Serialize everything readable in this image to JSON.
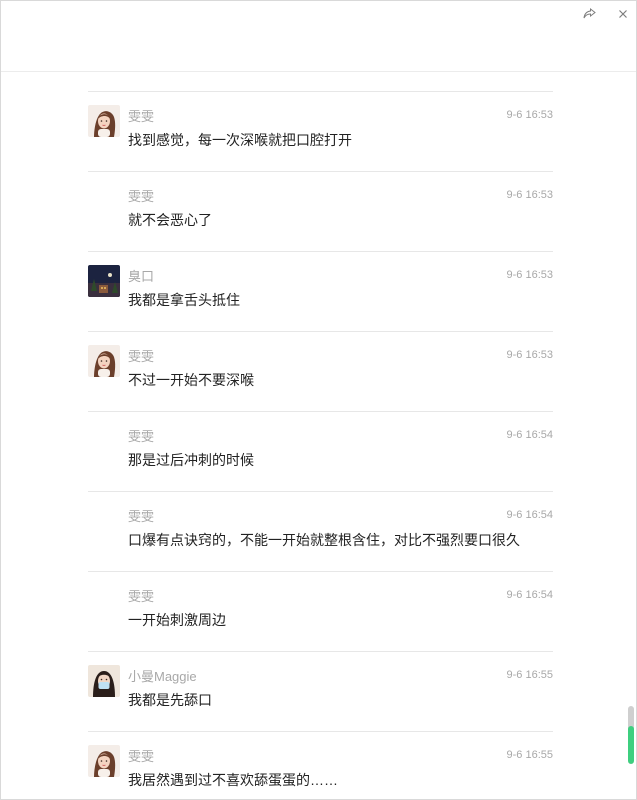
{
  "window": {
    "share_icon": "share-arrow-icon",
    "close_icon": "close-icon"
  },
  "messages": [
    {
      "name": "雯雯",
      "time": "9-6 16:53",
      "text": "找到感觉，每一次深喉就把口腔打开",
      "avatar": "woman-avatar"
    },
    {
      "name": "雯雯",
      "time": "9-6 16:53",
      "text": "就不会恶心了",
      "avatar": ""
    },
    {
      "name": "臭口",
      "time": "9-6 16:53",
      "text": "我都是拿舌头抵住",
      "avatar": "night-scene-avatar"
    },
    {
      "name": "雯雯",
      "time": "9-6 16:53",
      "text": "不过一开始不要深喉",
      "avatar": "woman-avatar"
    },
    {
      "name": "雯雯",
      "time": "9-6 16:54",
      "text": "那是过后冲刺的时候",
      "avatar": ""
    },
    {
      "name": "雯雯",
      "time": "9-6 16:54",
      "text": "口爆有点诀窍的，不能一开始就整根含住，对比不强烈要口很久",
      "avatar": ""
    },
    {
      "name": "雯雯",
      "time": "9-6 16:54",
      "text": "一开始刺激周边",
      "avatar": ""
    },
    {
      "name": "小曼Maggie",
      "time": "9-6 16:55",
      "text": "我都是先舔口",
      "avatar": "masked-girl-avatar"
    },
    {
      "name": "雯雯",
      "time": "9-6 16:55",
      "text": "我居然遇到过不喜欢舔蛋蛋的……",
      "avatar": "woman-avatar"
    }
  ],
  "colors": {
    "name": "#a8a8a8",
    "time": "#a8a8a8",
    "text": "#222222",
    "divider": "#e7e7e7",
    "scroll_accent": "#3ecf7f"
  },
  "scroll_position": 0.97
}
